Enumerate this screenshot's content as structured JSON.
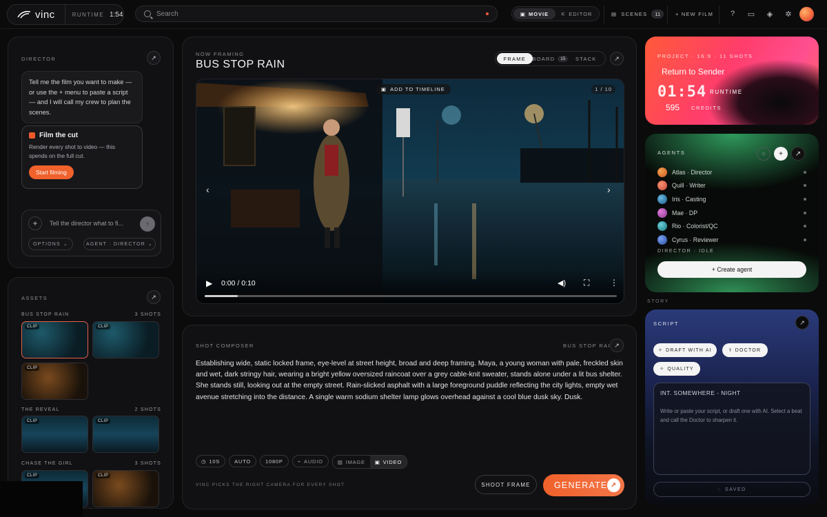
{
  "topbar": {
    "logo": "vinc",
    "runtime_label": "RUNTIME",
    "runtime_value": "1:54",
    "search_placeholder": "Search",
    "mode_tabs": [
      {
        "label": "MOVIE",
        "active": true
      },
      {
        "label": "EDITOR",
        "active": false
      }
    ],
    "scenes_label": "SCENES",
    "scenes_count": "11",
    "new_film_label": "+ NEW FILM",
    "icons": [
      "help-icon",
      "folder-icon",
      "layers-icon",
      "gear-icon"
    ]
  },
  "director": {
    "label": "DIRECTOR",
    "message": "Tell me the film you want to make — or use the + menu to paste a script — and I will call my crew to plan the scenes.",
    "film_cut_title": "Film the cut",
    "film_cut_desc": "Render every shot to video — this spends on the full cut.",
    "start_label": "Start filming",
    "input_placeholder": "Tell the director what to fi...",
    "options_label": "OPTIONS",
    "agent_label": "AGENT · DIRECTOR"
  },
  "assets": {
    "label": "ASSETS",
    "clip_label": "CLIP",
    "groups": [
      {
        "name": "BUS STOP RAIN",
        "count": "3 SHOTS"
      },
      {
        "name": "THE REVEAL",
        "count": "2 SHOTS"
      },
      {
        "name": "CHASE THE GIRL",
        "count": "3 SHOTS"
      }
    ]
  },
  "framing": {
    "label": "NOW FRAMING",
    "title": "BUS STOP RAIN",
    "tabs": [
      {
        "label": "FRAME",
        "active": true
      },
      {
        "label": "BOARD",
        "badge": "15",
        "active": false
      },
      {
        "label": "STACK",
        "active": false
      }
    ],
    "add_to_timeline": "ADD TO TIMELINE",
    "counter": "1 / 10",
    "time": "0:00 / 0:10",
    "progress": 0.08
  },
  "composer": {
    "label": "SHOT COMPOSER",
    "scene_tag": "BUS STOP RAIN",
    "prompt": "Establishing wide, static locked frame, eye-level at street height, broad and deep framing. Maya, a young woman with pale, freckled skin and wet, dark stringy hair, wearing a bright yellow oversized raincoat over a grey cable-knit sweater, stands alone under a lit bus shelter. She stands still, looking out at the empty street. Rain-slicked asphalt with a large foreground puddle reflecting the city lights, empty wet avenue stretching into the distance. A single warm sodium shelter lamp glows overhead against a cool blue dusk sky. Dusk.",
    "options": [
      {
        "label": "10S",
        "icon": "clock-icon"
      },
      {
        "label": "AUTO"
      },
      {
        "label": "1080P"
      },
      {
        "label": "AUDIO",
        "icon": "audio-icon"
      },
      {
        "label": "IMAGE",
        "icon": "image-icon"
      },
      {
        "label": "VIDEO",
        "icon": "video-icon"
      }
    ],
    "footnote": "VINC PICKS THE RIGHT CAMERA FOR EVERY SHOT",
    "shoot_label": "SHOOT FRAME",
    "generate_label": "GENERATE"
  },
  "project": {
    "meta": "PROJECT · 16:9 · 11 SHOTS",
    "name": "Return to Sender",
    "runtime_display": "01:54",
    "runtime_label": "RUNTIME",
    "credits": "595",
    "credits_label": "CREDITS"
  },
  "agents": {
    "label": "AGENTS",
    "list": [
      {
        "name": "Atlas · Director",
        "color": "#e8803a"
      },
      {
        "name": "Quill · Writer",
        "color": "#e86a4a"
      },
      {
        "name": "Iris · Casting",
        "color": "#3a8ab8"
      },
      {
        "name": "Mae · DP",
        "color": "#c05ab8"
      },
      {
        "name": "Rio · Colorist/QC",
        "color": "#3aa0a8"
      },
      {
        "name": "Cyrus · Reviewer",
        "color": "#4a7ad0"
      }
    ],
    "status": "DIRECTOR · IDLE",
    "create_label": "+ Create agent"
  },
  "story_label": "STORY",
  "script": {
    "label": "SCRIPT",
    "draft_label": "DRAFT WITH AI",
    "doctor_label": "DOCTOR",
    "quality_label": "QUALITY",
    "slug": "INT. SOMEWHERE - NIGHT",
    "hint": "Write or paste your script, or draft one with AI. Select a beat and call the Doctor to sharpen it.",
    "saved_label": "SAVED"
  }
}
